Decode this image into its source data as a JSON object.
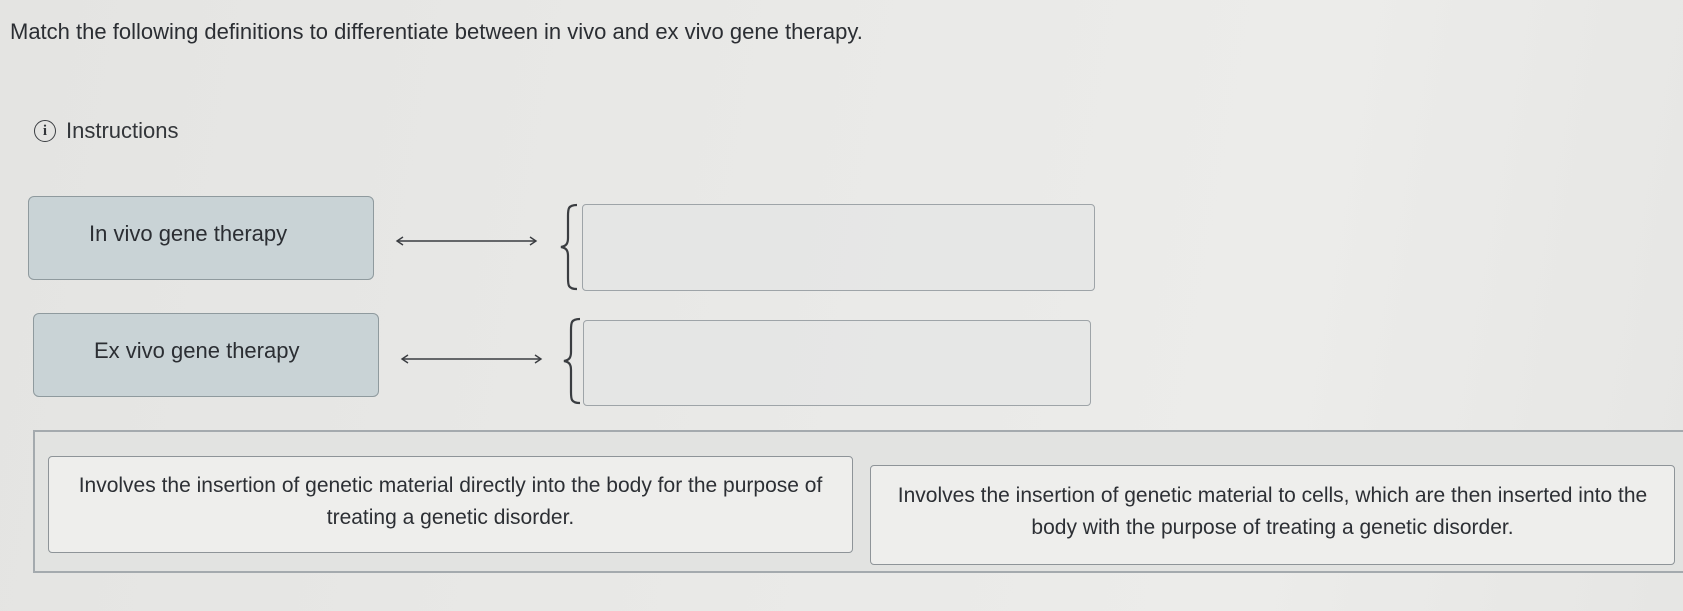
{
  "question": {
    "text": "Match the following definitions to differentiate between in vivo and ex vivo gene therapy."
  },
  "instructions": {
    "icon": "info-icon",
    "icon_glyph": "i",
    "label": "Instructions"
  },
  "terms": [
    {
      "label": "In vivo gene therapy"
    },
    {
      "label": "Ex vivo gene therapy"
    }
  ],
  "drop_targets": [
    {
      "value": ""
    },
    {
      "value": ""
    }
  ],
  "answer_bank": [
    {
      "text": "Involves the insertion of genetic material directly into the body for the purpose of treating a genetic disorder."
    },
    {
      "text": "Involves the insertion of genetic material to cells, which are then inserted into the body with the purpose of treating a genetic disorder."
    }
  ],
  "colors": {
    "term_background": "#c9d3d6",
    "border": "#8f9a9e",
    "text": "#2b2e33"
  }
}
